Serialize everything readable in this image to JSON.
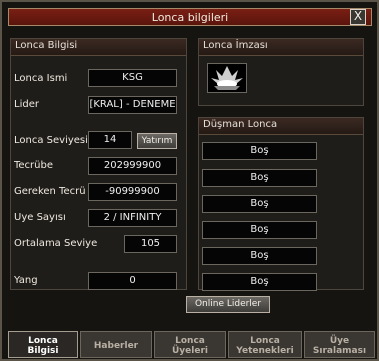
{
  "window": {
    "title": "Lonca bilgileri",
    "close_symbol": "X"
  },
  "left_panel": {
    "header": "Lonca Bilgisi",
    "fields": [
      {
        "label": "Lonca İsmi",
        "value": "KSG"
      },
      {
        "label": "Lider",
        "value": "[KRAL] - DENEME"
      },
      {
        "label": "Lonca Seviyesi",
        "value": "14"
      },
      {
        "label": "Tecrübe",
        "value": "202999900"
      },
      {
        "label": "Gereken Tecrübe",
        "value": "-90999900"
      },
      {
        "label": "Üye Sayısı",
        "value": "2 / INFINITY"
      },
      {
        "label": "Ortalama Seviye",
        "value": "105"
      },
      {
        "label": "Yang",
        "value": "0"
      }
    ],
    "invest_button": "Yatırım"
  },
  "right_top": {
    "header": "Lonca İmzası"
  },
  "right_bottom": {
    "header": "Düşman Lonca",
    "slots": [
      "Boş",
      "Boş",
      "Boş",
      "Boş",
      "Boş",
      "Boş"
    ]
  },
  "online_leaders_button": "Online Liderler",
  "tabs": [
    {
      "label": "Lonca",
      "label2": "Bilgisi"
    },
    {
      "label": "Haberler",
      "label2": ""
    },
    {
      "label": "Lonca",
      "label2": "Üyeleri"
    },
    {
      "label": "Lonca",
      "label2": "Yetenekleri"
    },
    {
      "label": "Üye",
      "label2": "Sıralaması"
    }
  ]
}
